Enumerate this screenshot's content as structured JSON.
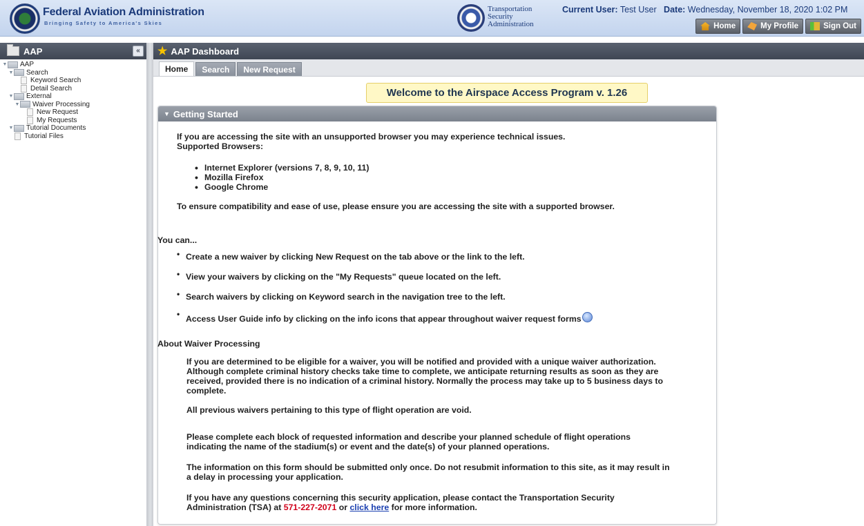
{
  "header": {
    "faa_title": "Federal Aviation Administration",
    "faa_tagline": "Bringing Safety to America's Skies",
    "tsa_name_lines": [
      "Transportation",
      "Security",
      "Administration"
    ],
    "current_user_label": "Current User:",
    "current_user_value": "Test User",
    "date_label": "Date:",
    "date_value": "Wednesday, November 18, 2020 1:02 PM",
    "buttons": {
      "home": "Home",
      "profile": "My Profile",
      "signout": "Sign Out"
    }
  },
  "sidebar": {
    "title": "AAP",
    "tree": [
      {
        "label": "AAP",
        "level": 0,
        "type": "folder"
      },
      {
        "label": "Search",
        "level": 1,
        "type": "folder"
      },
      {
        "label": "Keyword Search",
        "level": 2,
        "type": "doc"
      },
      {
        "label": "Detail Search",
        "level": 2,
        "type": "doc"
      },
      {
        "label": "External",
        "level": 1,
        "type": "folder"
      },
      {
        "label": "Waiver Processing",
        "level": 2,
        "type": "folder"
      },
      {
        "label": "New Request",
        "level": 3,
        "type": "doc"
      },
      {
        "label": "My Requests",
        "level": 3,
        "type": "doc"
      },
      {
        "label": "Tutorial Documents",
        "level": 1,
        "type": "folder"
      },
      {
        "label": "Tutorial Files",
        "level": 2,
        "type": "doc"
      }
    ]
  },
  "main": {
    "title": "AAP Dashboard",
    "tabs": [
      "Home",
      "Search",
      "New Request"
    ],
    "welcome": "Welcome to the Airspace Access Program v. 1.26",
    "panel_title": "Getting Started",
    "browser_warning": "If you are accessing the site with an unsupported browser you may experience technical issues.",
    "supported_label": "Supported Browsers:",
    "browsers": [
      "Internet Explorer (versions 7, 8, 9, 10, 11)",
      "Mozilla Firefox",
      "Google Chrome"
    ],
    "compat_note": "To ensure compatibility and ease of use, please ensure you are accessing the site with a supported browser.",
    "you_can": "You can...",
    "actions": [
      "Create a new waiver by clicking New Request on the tab above or the link to the left.",
      "View your waivers by clicking on the \"My Requests\" queue located on the left.",
      "Search waivers by clicking on Keyword search in the navigation tree to the left.",
      "Access User Guide info by clicking on the info icons that appear throughout waiver request forms"
    ],
    "about_title": "About Waiver Processing",
    "about_p1_lines": [
      "If you are determined to be eligible for a waiver, you will be notified and provided with a unique waiver authorization.",
      "Although complete criminal history checks take time to complete, we anticipate returning results as soon as they are",
      "received, provided there is no indication of a criminal history. Normally the process may take up to 5 business days to",
      "complete."
    ],
    "about_p2": "All previous waivers pertaining to this type of flight operation are void.",
    "about_p3_lines": [
      "Please complete each block of requested information and describe your planned schedule of flight operations",
      "indicating the name of the stadium(s) or event and the date(s) of your planned operations."
    ],
    "about_p4_lines": [
      "The information on this form should be submitted only once. Do not resubmit information to this site, as it may result in",
      "a delay in processing your application."
    ],
    "contact_line1": "If you have any questions concerning this security application, please contact the Transportation Security",
    "contact_prefix": "Administration (TSA) at ",
    "phone": "571-227-2071",
    "or": " or ",
    "click_here": "click here",
    "contact_suffix": " for more information."
  }
}
